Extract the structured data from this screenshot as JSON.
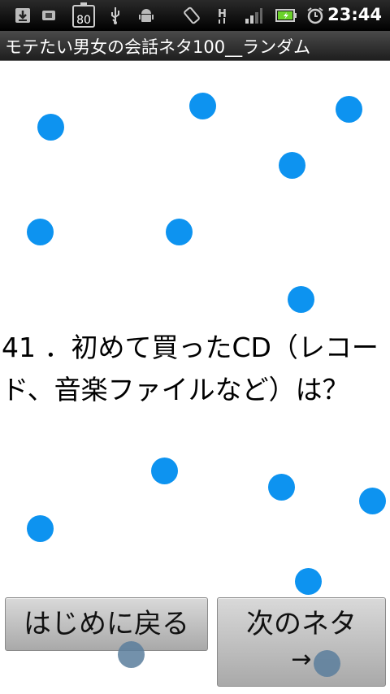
{
  "status_bar": {
    "battery_level_label": "80",
    "time": "23:44",
    "network_label": "H",
    "icons": [
      "download-icon",
      "settings-icon",
      "battery-small-icon",
      "usb-icon",
      "android-icon",
      "rotate-icon",
      "network-h-icon",
      "signal-icon",
      "battery-icon",
      "alarm-icon"
    ]
  },
  "title_bar": {
    "title": "モテたい男女の会話ネタ100__ランダム"
  },
  "question": {
    "text": "41 ．初めて買ったCD（レコード、音楽ファイルなど）は？"
  },
  "buttons": {
    "back_label": "はじめに戻る",
    "next_label": "次のネタ",
    "next_arrow": "→"
  },
  "colors": {
    "dot": "#0d93f0",
    "background": "#ffffff",
    "button_gradient_top": "#d9d9d9",
    "button_gradient_bottom": "#a9a9a9"
  }
}
